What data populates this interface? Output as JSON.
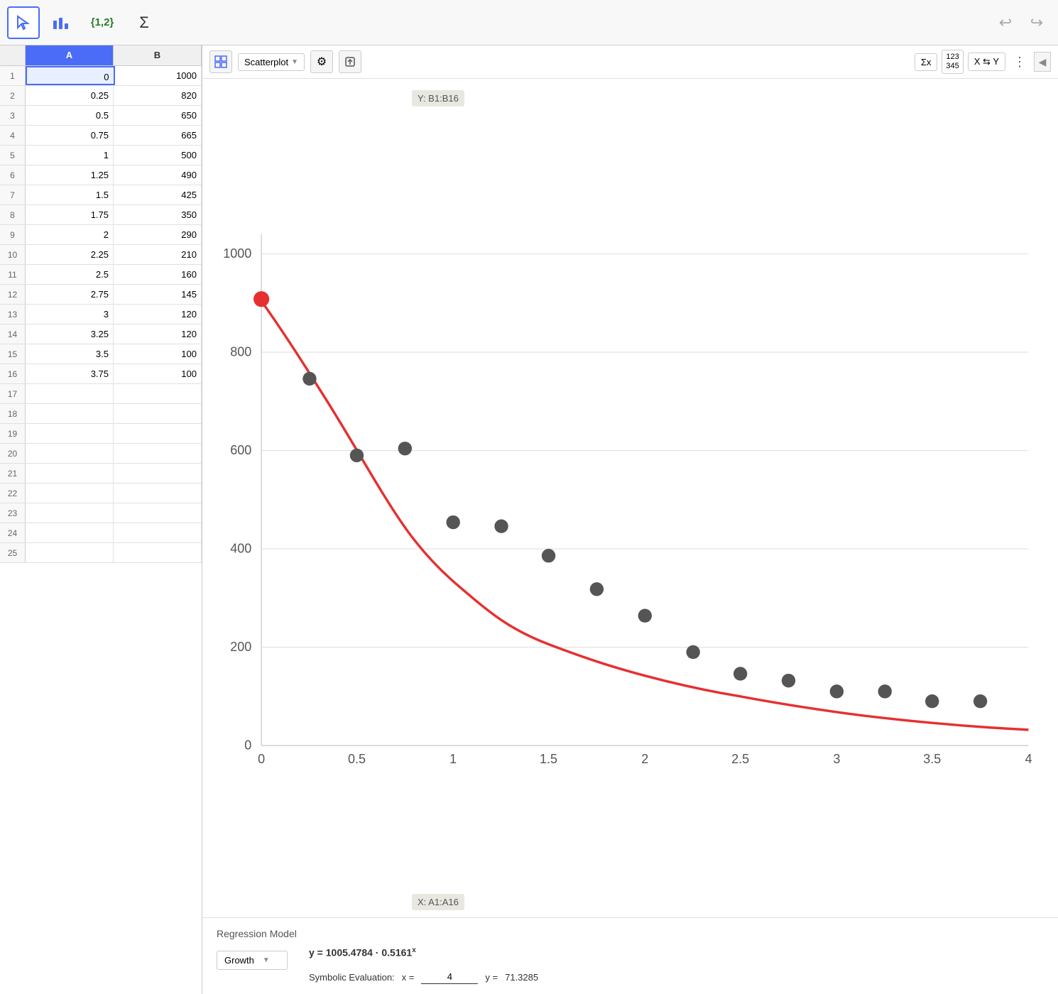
{
  "toolbar": {
    "tools": [
      {
        "name": "cursor",
        "icon": "↖",
        "active": true
      },
      {
        "name": "chart",
        "icon": "📊",
        "active": false
      },
      {
        "name": "set",
        "icon": "{1,2}",
        "active": false
      },
      {
        "name": "sigma",
        "icon": "Σ",
        "active": false
      }
    ],
    "undo_label": "↩",
    "redo_label": "↪"
  },
  "spreadsheet": {
    "col_a_header": "A",
    "col_b_header": "B",
    "selected_cell": "A1",
    "rows": [
      {
        "row": 1,
        "a": "0",
        "b": "1000"
      },
      {
        "row": 2,
        "a": "0.25",
        "b": "820"
      },
      {
        "row": 3,
        "a": "0.5",
        "b": "650"
      },
      {
        "row": 4,
        "a": "0.75",
        "b": "665"
      },
      {
        "row": 5,
        "a": "1",
        "b": "500"
      },
      {
        "row": 6,
        "a": "1.25",
        "b": "490"
      },
      {
        "row": 7,
        "a": "1.5",
        "b": "425"
      },
      {
        "row": 8,
        "a": "1.75",
        "b": "350"
      },
      {
        "row": 9,
        "a": "2",
        "b": "290"
      },
      {
        "row": 10,
        "a": "2.25",
        "b": "210"
      },
      {
        "row": 11,
        "a": "2.5",
        "b": "160"
      },
      {
        "row": 12,
        "a": "2.75",
        "b": "145"
      },
      {
        "row": 13,
        "a": "3",
        "b": "120"
      },
      {
        "row": 14,
        "a": "3.25",
        "b": "120"
      },
      {
        "row": 15,
        "a": "3.5",
        "b": "100"
      },
      {
        "row": 16,
        "a": "3.75",
        "b": "100"
      },
      {
        "row": 17,
        "a": "",
        "b": ""
      },
      {
        "row": 18,
        "a": "",
        "b": ""
      },
      {
        "row": 19,
        "a": "",
        "b": ""
      },
      {
        "row": 20,
        "a": "",
        "b": ""
      },
      {
        "row": 21,
        "a": "",
        "b": ""
      },
      {
        "row": 22,
        "a": "",
        "b": ""
      },
      {
        "row": 23,
        "a": "",
        "b": ""
      },
      {
        "row": 24,
        "a": "",
        "b": ""
      },
      {
        "row": 25,
        "a": "",
        "b": ""
      }
    ]
  },
  "chart": {
    "type": "Scatterplot",
    "y_axis_label": "Y: B1:B16",
    "x_axis_label": "X: A1:A16",
    "sigma_label": "Σx",
    "numbers_label": "123\n345",
    "swap_label": "X ⇆ Y",
    "more_label": "⋮",
    "collapse_label": "▶",
    "x_ticks": [
      "0",
      "0.5",
      "1",
      "1.5",
      "2",
      "2.5",
      "3",
      "3.5",
      "4"
    ],
    "y_ticks": [
      "0",
      "200",
      "400",
      "600",
      "800",
      "1000"
    ],
    "data_points": [
      {
        "x": 0,
        "y": 1000
      },
      {
        "x": 0.25,
        "y": 820
      },
      {
        "x": 0.5,
        "y": 650
      },
      {
        "x": 0.75,
        "y": 665
      },
      {
        "x": 1,
        "y": 500
      },
      {
        "x": 1.25,
        "y": 490
      },
      {
        "x": 1.5,
        "y": 425
      },
      {
        "x": 1.75,
        "y": 350
      },
      {
        "x": 2,
        "y": 290
      },
      {
        "x": 2.25,
        "y": 210
      },
      {
        "x": 2.5,
        "y": 160
      },
      {
        "x": 2.75,
        "y": 145
      },
      {
        "x": 3,
        "y": 120
      },
      {
        "x": 3.25,
        "y": 120
      },
      {
        "x": 3.5,
        "y": 100
      },
      {
        "x": 3.75,
        "y": 100
      }
    ],
    "accent_color": "#e63030"
  },
  "regression": {
    "title": "Regression Model",
    "formula": "y = 1005.4784 · 0.5161",
    "exponent": "x",
    "type": "Growth",
    "symbolic_label": "Symbolic Evaluation:",
    "x_label": "x =",
    "x_value": "4",
    "y_label": "y =",
    "y_value": "71.3285"
  }
}
